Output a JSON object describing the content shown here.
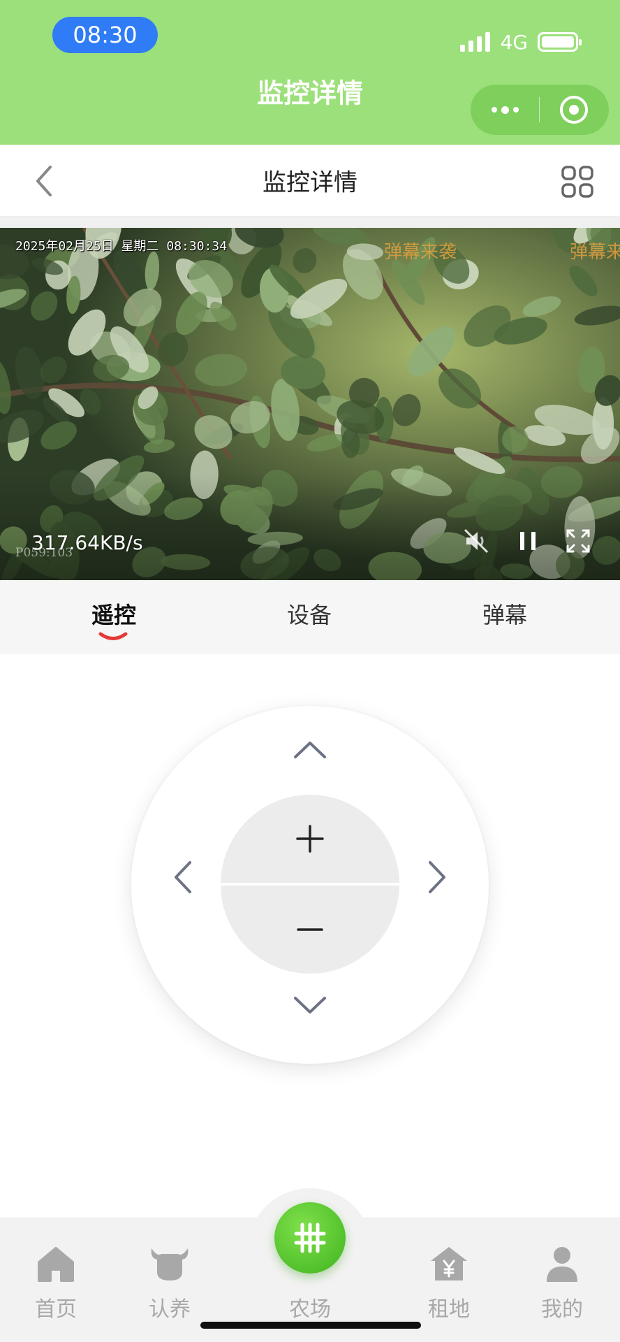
{
  "status_bar": {
    "time": "08:30",
    "network": "4G"
  },
  "wechat_header": {
    "title": "监控详情",
    "more_icon": "more-dots-icon",
    "close_icon": "target-close-icon"
  },
  "navbar": {
    "title": "监控详情",
    "back_icon": "chevron-left-icon",
    "grid_icon": "grid-icon"
  },
  "video": {
    "osd_datetime": "2025年02月25日 星期二 08:30:34",
    "danmaku": [
      "弹幕来袭",
      "弹幕来"
    ],
    "camera_code": "P059:103",
    "speed": "317.64KB/s",
    "controls": [
      "mute-icon",
      "pause-icon",
      "fullscreen-icon"
    ]
  },
  "tabs": [
    {
      "label": "遥控",
      "active": true
    },
    {
      "label": "设备",
      "active": false
    },
    {
      "label": "弹幕",
      "active": false
    }
  ],
  "remote": {
    "up_icon": "chevron-up-icon",
    "down_icon": "chevron-down-icon",
    "left_icon": "chevron-left-icon",
    "right_icon": "chevron-right-icon",
    "zoom_in_icon": "plus-icon",
    "zoom_out_icon": "minus-icon"
  },
  "tabbar": {
    "items": [
      {
        "label": "首页",
        "icon": "home-icon"
      },
      {
        "label": "认养",
        "icon": "cow-icon"
      },
      {
        "label": "农场",
        "icon": "hashtag-icon"
      },
      {
        "label": "租地",
        "icon": "land-yen-icon"
      },
      {
        "label": "我的",
        "icon": "user-icon"
      }
    ]
  },
  "colors": {
    "header_green": "#9ce07b",
    "accent_red": "#e53935",
    "tab_active_green": "#3fb41f",
    "danmaku_orange": "#e3a03f"
  }
}
